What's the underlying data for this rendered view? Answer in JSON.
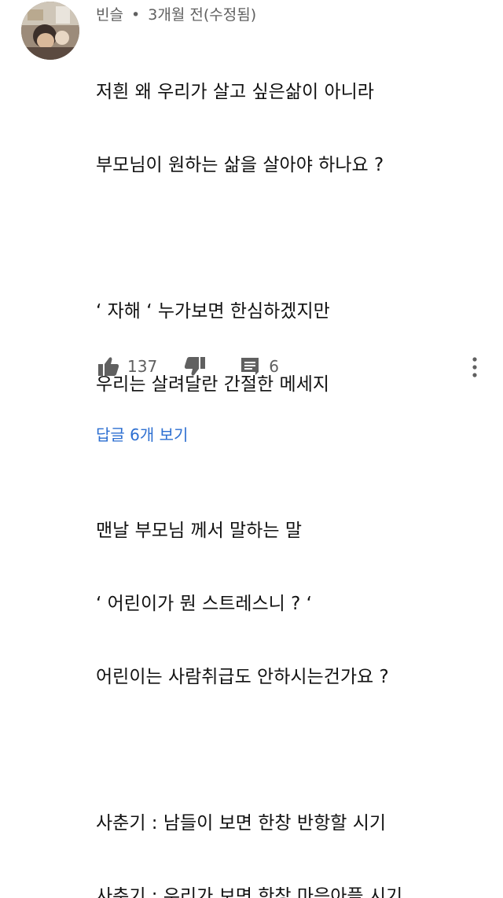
{
  "comment": {
    "author": "빈슬",
    "separator": "•",
    "time": "3개월 전(수정됨)",
    "lines": [
      "저흰 왜 우리가 살고 싶은삶이 아니라",
      "부모님이 원하는 삶을 살아야 하나요 ?",
      "",
      "‘ 자해 ‘ 누가보면 한심하겠지만",
      "우리는 살려달란 간절한 메세지",
      "",
      "맨날 부모님 께서 말하는 말",
      "‘ 어린이가 뭔 스트레스니 ? ‘",
      "어린이는 사람취급도 안하시는건가요 ?",
      "",
      "사춘기 : 남들이 보면 한창 반항할 시기",
      "사춘기 : 우리가 보면 한창 마음아플 시기"
    ]
  },
  "actions": {
    "like_icon": "thumbs-up-icon",
    "like_count": "137",
    "dislike_icon": "thumbs-down-icon",
    "reply_icon": "comment-icon",
    "reply_count": "6",
    "more_icon": "more-vert-icon"
  },
  "replies": {
    "label": "답글 6개 보기"
  },
  "colors": {
    "link_blue": "#2d6fd1",
    "meta_gray": "#606060",
    "icon_gray": "#606060"
  }
}
